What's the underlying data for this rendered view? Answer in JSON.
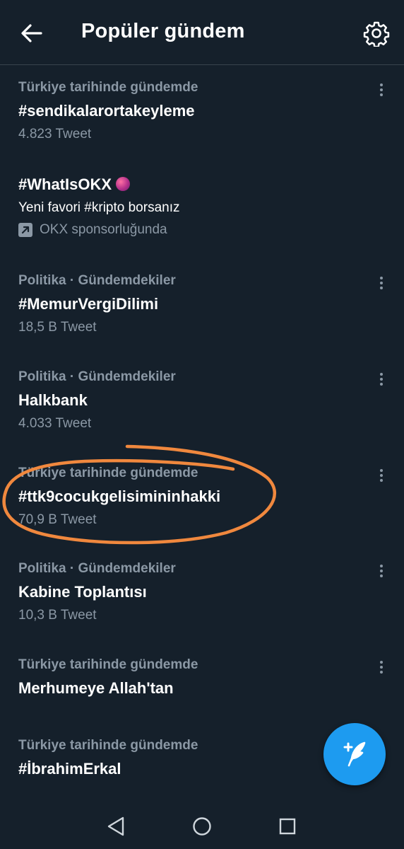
{
  "header": {
    "title": "Popüler gündem",
    "back_icon": "arrow-left-icon",
    "settings_icon": "gear-icon"
  },
  "trends": [
    {
      "context": "Türkiye tarihinde gündemde",
      "name": "#sendikalarortakeyleme",
      "count": "4.823 Tweet"
    },
    {
      "name": "#WhatIsOKX",
      "description": "Yeni favori #kripto borsanız",
      "promo": "OKX sponsorluğunda"
    },
    {
      "context": "Politika · Gündemdekiler",
      "name": "#MemurVergiDilimi",
      "count": "18,5 B Tweet"
    },
    {
      "context": "Politika · Gündemdekiler",
      "name": "Halkbank",
      "count": "4.033 Tweet"
    },
    {
      "context": "Türkiye tarihinde gündemde",
      "name": "#ttk9cocukgelisimininhakki",
      "count": "70,9 B Tweet"
    },
    {
      "context": "Politika · Gündemdekiler",
      "name": "Kabine Toplantısı",
      "count": "10,3 B Tweet"
    },
    {
      "context": "Türkiye tarihinde gündemde",
      "name": "Merhumeye Allah'tan"
    },
    {
      "context": "Türkiye tarihinde gündemde",
      "name": "#İbrahimErkal"
    }
  ],
  "colors": {
    "background": "#15202b",
    "secondary_text": "#8b98a5",
    "accent": "#1d9bf0",
    "annotation": "#f0883e"
  },
  "fab": {
    "icon": "compose-tweet-icon"
  },
  "system_nav": {
    "icons": [
      "nav-back-icon",
      "nav-home-icon",
      "nav-recents-icon"
    ]
  }
}
